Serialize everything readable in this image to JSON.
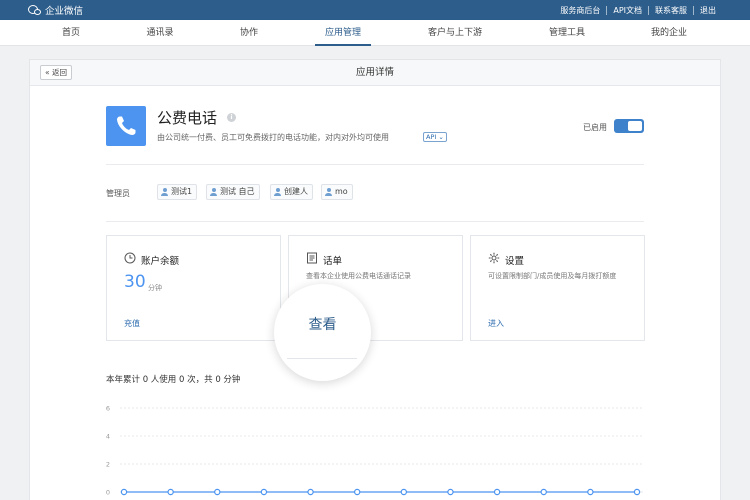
{
  "topbar": {
    "brand": "企业微信",
    "links": [
      "服务商后台",
      "API文档",
      "联系客服",
      "退出"
    ]
  },
  "nav": {
    "items": [
      "首页",
      "通讯录",
      "协作",
      "应用管理",
      "客户与上下游",
      "管理工具",
      "我的企业"
    ],
    "active": "应用管理"
  },
  "panel": {
    "back_label": "返回",
    "title": "应用详情"
  },
  "app": {
    "icon": "phone-icon",
    "name": "公费电话",
    "description": "由公司统一付费、员工可免费拨打的电话功能，对内对外均可使用",
    "api_tag": "API",
    "status_label": "已启用",
    "enabled": true,
    "accent_color": "#4c94f0"
  },
  "admins": {
    "label": "管理员",
    "people": [
      "测试1",
      "测试 自己",
      "创建人",
      "mo"
    ]
  },
  "cards": {
    "balance": {
      "title": "账户余额",
      "icon": "clock-icon",
      "value": "30",
      "unit": "分钟",
      "link": "充值"
    },
    "records": {
      "title": "话单",
      "icon": "list-icon",
      "desc": "查看本企业使用公费电话通话记录",
      "link": "查看"
    },
    "settings": {
      "title": "设置",
      "icon": "gear-icon",
      "desc": "可设置限制部门/成员使用及每月拨打额度",
      "link": "进入"
    }
  },
  "summary": "本年累计 0 人使用 0 次，共 0 分钟",
  "chart_data": {
    "type": "line",
    "y_ticks": [
      "6",
      "4",
      "2",
      "0"
    ],
    "ylim": [
      0,
      6
    ],
    "series": [
      {
        "values": [
          0,
          0,
          0,
          0,
          0,
          0,
          0,
          0,
          0,
          0,
          0,
          0
        ]
      }
    ],
    "grid": true,
    "line_color": "#4c94f0"
  }
}
